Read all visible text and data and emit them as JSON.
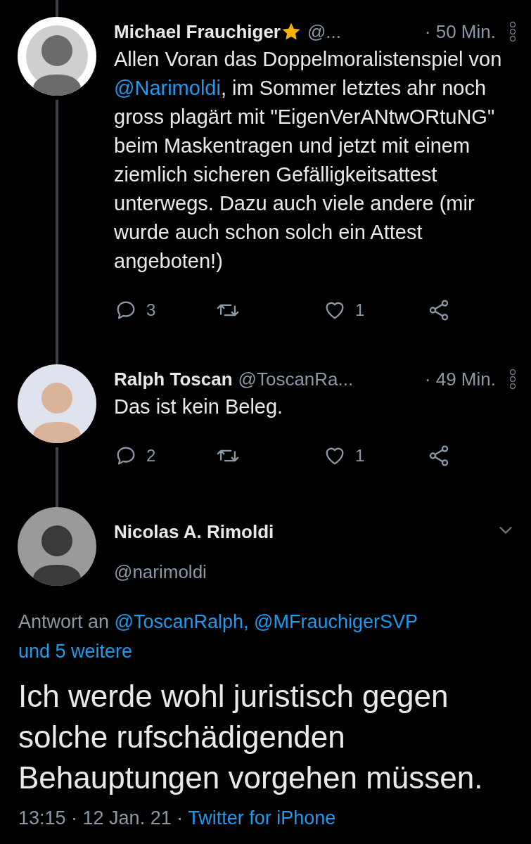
{
  "replies": [
    {
      "name": "Michael Frauchiger",
      "verified_star": true,
      "handle": "@...",
      "time": "· 50 Min.",
      "body": [
        {
          "kind": "text",
          "text": "Allen Voran das Doppelmoralistenspiel von "
        },
        {
          "kind": "mention",
          "text": "@Narimoldi"
        },
        {
          "kind": "text",
          "text": ", im Sommer letztes ahr noch gross plagärt mit \"EigenVerANtwORtuNG\" beim Maskentragen und jetzt mit einem ziemlich sicheren Gefälligkeitsattest unterwegs. Dazu auch viele andere (mir wurde auch schon solch ein Attest angeboten!)"
        }
      ],
      "replies": "3",
      "likes": "1"
    },
    {
      "name": "Ralph Toscan",
      "verified_star": false,
      "handle": "@ToscanRa...",
      "time": "· 49 Min.",
      "body": [
        {
          "kind": "text",
          "text": "Das ist kein Beleg."
        }
      ],
      "replies": "2",
      "likes": "1"
    }
  ],
  "main": {
    "name": "Nicolas A. Rimoldi",
    "handle": "@narimoldi",
    "reply_prefix": "Antwort an",
    "reply_to": "@ToscanRalph, @MFrauchigerSVP",
    "reply_more": "und 5 weitere",
    "text": "Ich werde wohl juristisch gegen solche rufschädigenden Behauptungen vorgehen müssen.",
    "time": "13:15 · 12 Jan. 21 ·",
    "source": "Twitter for iPhone"
  }
}
